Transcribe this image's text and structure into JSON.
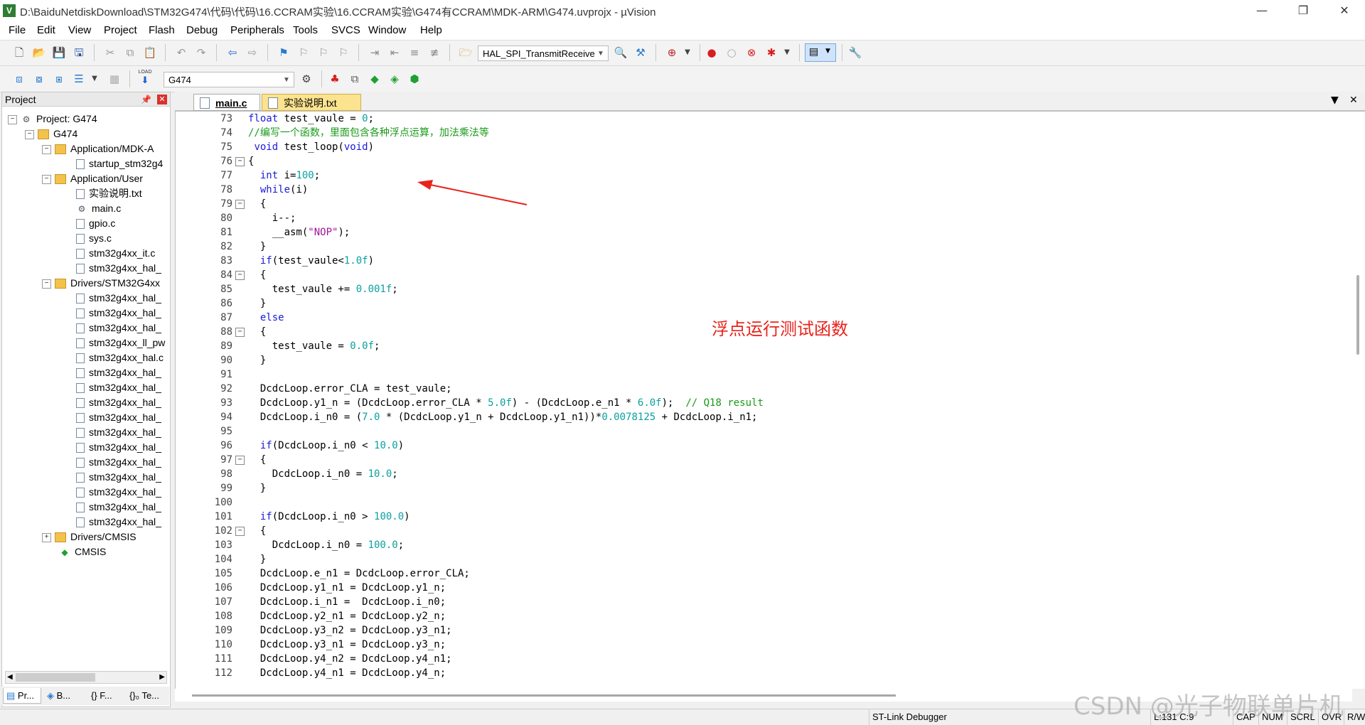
{
  "window": {
    "title": "D:\\BaiduNetdiskDownload\\STM32G474\\代码\\代码\\16.CCRAM实验\\16.CCRAM实验\\G474有CCRAM\\MDK-ARM\\G474.uvprojx - µVision",
    "minimize": "—",
    "restore": "❐",
    "close": "✕"
  },
  "menu": [
    "File",
    "Edit",
    "View",
    "Project",
    "Flash",
    "Debug",
    "Peripherals",
    "Tools",
    "SVCS",
    "Window",
    "Help"
  ],
  "toolbar": {
    "function_combo": "HAL_SPI_TransmitReceive",
    "target_combo": "G474",
    "load_label": "LOAD"
  },
  "project_panel": {
    "title": "Project",
    "items": [
      {
        "label": "Project: G474"
      },
      {
        "label": "G474"
      },
      {
        "label": "Application/MDK-A"
      },
      {
        "label": "startup_stm32g4"
      },
      {
        "label": "Application/User"
      },
      {
        "label": "实验说明.txt"
      },
      {
        "label": "main.c"
      },
      {
        "label": "gpio.c"
      },
      {
        "label": "sys.c"
      },
      {
        "label": "stm32g4xx_it.c"
      },
      {
        "label": "stm32g4xx_hal_"
      },
      {
        "label": "Drivers/STM32G4xx"
      },
      {
        "label": "stm32g4xx_hal_"
      },
      {
        "label": "stm32g4xx_hal_"
      },
      {
        "label": "stm32g4xx_hal_"
      },
      {
        "label": "stm32g4xx_ll_pw"
      },
      {
        "label": "stm32g4xx_hal.c"
      },
      {
        "label": "stm32g4xx_hal_"
      },
      {
        "label": "stm32g4xx_hal_"
      },
      {
        "label": "stm32g4xx_hal_"
      },
      {
        "label": "stm32g4xx_hal_"
      },
      {
        "label": "stm32g4xx_hal_"
      },
      {
        "label": "stm32g4xx_hal_"
      },
      {
        "label": "stm32g4xx_hal_"
      },
      {
        "label": "stm32g4xx_hal_"
      },
      {
        "label": "stm32g4xx_hal_"
      },
      {
        "label": "stm32g4xx_hal_"
      },
      {
        "label": "stm32g4xx_hal_"
      },
      {
        "label": "Drivers/CMSIS"
      },
      {
        "label": "CMSIS"
      }
    ],
    "bottom_tabs": [
      "Pr...",
      "B...",
      "{} F...",
      "{}₀ Te..."
    ]
  },
  "editor_tabs": [
    {
      "label": "main.c"
    },
    {
      "label": "实验说明.txt"
    }
  ],
  "code": [
    {
      "n": "73",
      "t": "float test_vaule = 0;"
    },
    {
      "n": "74",
      "t": "//编写一个函数，里面包含各种浮点运算，加法乘法等"
    },
    {
      "n": "75",
      "t": " void test_loop(void)"
    },
    {
      "n": "76",
      "t": "{"
    },
    {
      "n": "77",
      "t": "  int i=100;"
    },
    {
      "n": "78",
      "t": "  while(i)"
    },
    {
      "n": "79",
      "t": "  {"
    },
    {
      "n": "80",
      "t": "    i--;"
    },
    {
      "n": "81",
      "t": "    __asm(\"NOP\");"
    },
    {
      "n": "82",
      "t": "  }"
    },
    {
      "n": "83",
      "t": "  if(test_vaule<1.0f)"
    },
    {
      "n": "84",
      "t": "  {"
    },
    {
      "n": "85",
      "t": "    test_vaule += 0.001f;"
    },
    {
      "n": "86",
      "t": "  }"
    },
    {
      "n": "87",
      "t": "  else"
    },
    {
      "n": "88",
      "t": "  {"
    },
    {
      "n": "89",
      "t": "    test_vaule = 0.0f;"
    },
    {
      "n": "90",
      "t": "  }"
    },
    {
      "n": "91",
      "t": ""
    },
    {
      "n": "92",
      "t": "  DcdcLoop.error_CLA = test_vaule;"
    },
    {
      "n": "93",
      "t": "  DcdcLoop.y1_n = (DcdcLoop.error_CLA * 5.0f) - (DcdcLoop.e_n1 * 6.0f);  // Q18 result"
    },
    {
      "n": "94",
      "t": "  DcdcLoop.i_n0 = (7.0 * (DcdcLoop.y1_n + DcdcLoop.y1_n1))*0.0078125 + DcdcLoop.i_n1;"
    },
    {
      "n": "95",
      "t": ""
    },
    {
      "n": "96",
      "t": "  if(DcdcLoop.i_n0 < 10.0)"
    },
    {
      "n": "97",
      "t": "  {"
    },
    {
      "n": "98",
      "t": "    DcdcLoop.i_n0 = 10.0;"
    },
    {
      "n": "99",
      "t": "  }"
    },
    {
      "n": "100",
      "t": ""
    },
    {
      "n": "101",
      "t": "  if(DcdcLoop.i_n0 > 100.0)"
    },
    {
      "n": "102",
      "t": "  {"
    },
    {
      "n": "103",
      "t": "    DcdcLoop.i_n0 = 100.0;"
    },
    {
      "n": "104",
      "t": "  }"
    },
    {
      "n": "105",
      "t": "  DcdcLoop.e_n1 = DcdcLoop.error_CLA;"
    },
    {
      "n": "106",
      "t": "  DcdcLoop.y1_n1 = DcdcLoop.y1_n;"
    },
    {
      "n": "107",
      "t": "  DcdcLoop.i_n1 =  DcdcLoop.i_n0;"
    },
    {
      "n": "108",
      "t": "  DcdcLoop.y2_n1 = DcdcLoop.y2_n;"
    },
    {
      "n": "109",
      "t": "  DcdcLoop.y3_n2 = DcdcLoop.y3_n1;"
    },
    {
      "n": "110",
      "t": "  DcdcLoop.y3_n1 = DcdcLoop.y3_n;"
    },
    {
      "n": "111",
      "t": "  DcdcLoop.y4_n2 = DcdcLoop.y4_n1;"
    },
    {
      "n": "112",
      "t": "  DcdcLoop.y4_n1 = DcdcLoop.y4_n;"
    }
  ],
  "annotation": "浮点运行测试函数",
  "status": {
    "debugger": "ST-Link Debugger",
    "position": "L:131 C:9",
    "flags": [
      "CAP",
      "NUM",
      "SCRL",
      "OVR",
      "R/W"
    ]
  },
  "watermark": "CSDN @光子物联单片机",
  "colors": {
    "keyword": "#1a1ad8",
    "number": "#0aa0a0",
    "string": "#a0149a",
    "comment": "#1a9a1a",
    "annotation": "#e8231c"
  }
}
